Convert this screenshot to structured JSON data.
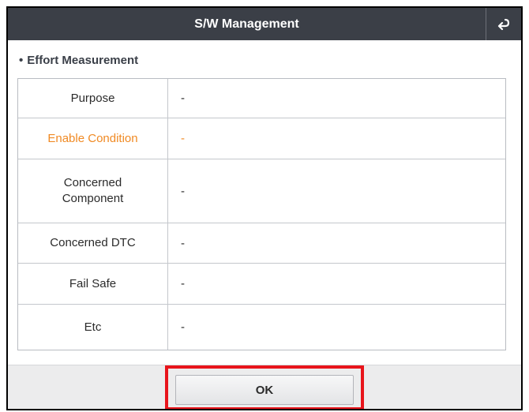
{
  "window": {
    "title": "S/W Management",
    "back_icon": "return-arrow-icon"
  },
  "section": {
    "bullet": "•",
    "title": "Effort Measurement"
  },
  "table": {
    "rows": [
      {
        "label": "Purpose",
        "value": "-"
      },
      {
        "label": "Enable Condition",
        "value": "-"
      },
      {
        "label": "Concerned Component",
        "value": "-"
      },
      {
        "label": "Concerned DTC",
        "value": "-"
      },
      {
        "label": "Fail Safe",
        "value": "-"
      },
      {
        "label": "Etc",
        "value": "-"
      }
    ]
  },
  "footer": {
    "ok_label": "OK"
  },
  "colors": {
    "titlebar": "#3b3f47",
    "highlight_text": "#f08a24",
    "annotation_box": "#e8141b"
  }
}
